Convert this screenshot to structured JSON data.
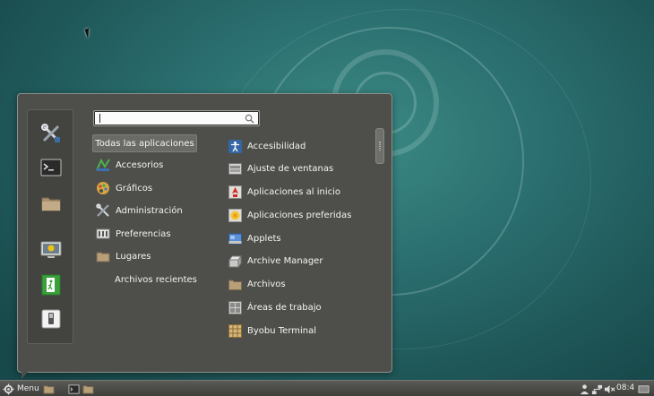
{
  "search": {
    "placeholder": ""
  },
  "favorites": [
    {
      "icon": "tools-icon"
    },
    {
      "icon": "terminal-icon"
    },
    {
      "icon": "folder-icon"
    },
    {
      "icon": "lock-screen-icon"
    },
    {
      "icon": "logout-icon"
    },
    {
      "icon": "shutdown-icon"
    }
  ],
  "categories": [
    {
      "label": "Todas las aplicaciones",
      "selected": true
    },
    {
      "label": "Accesorios",
      "icon": "accessories-icon"
    },
    {
      "label": "Gráficos",
      "icon": "graphics-icon"
    },
    {
      "label": "Administración",
      "icon": "administration-icon"
    },
    {
      "label": "Preferencias",
      "icon": "preferences-icon"
    },
    {
      "label": "Lugares",
      "icon": "places-folder-icon"
    },
    {
      "label": "Archivos recientes"
    }
  ],
  "applications": [
    {
      "label": "Accesibilidad",
      "icon": "accessibility-icon"
    },
    {
      "label": "Ajuste de ventanas",
      "icon": "window-tiling-icon"
    },
    {
      "label": "Aplicaciones al inicio",
      "icon": "startup-apps-icon"
    },
    {
      "label": "Aplicaciones preferidas",
      "icon": "preferred-apps-icon"
    },
    {
      "label": "Applets",
      "icon": "applets-icon"
    },
    {
      "label": "Archive Manager",
      "icon": "archive-manager-icon"
    },
    {
      "label": "Archivos",
      "icon": "files-icon"
    },
    {
      "label": "Áreas de trabajo",
      "icon": "workspaces-icon"
    },
    {
      "label": "Byobu Terminal",
      "icon": "byobu-terminal-icon"
    }
  ],
  "panel": {
    "menu_label": "Menu",
    "clock": "08:4"
  },
  "colors": {
    "menu_bg": "#4e4f4b",
    "desktop_teal": "#2b6f70"
  }
}
